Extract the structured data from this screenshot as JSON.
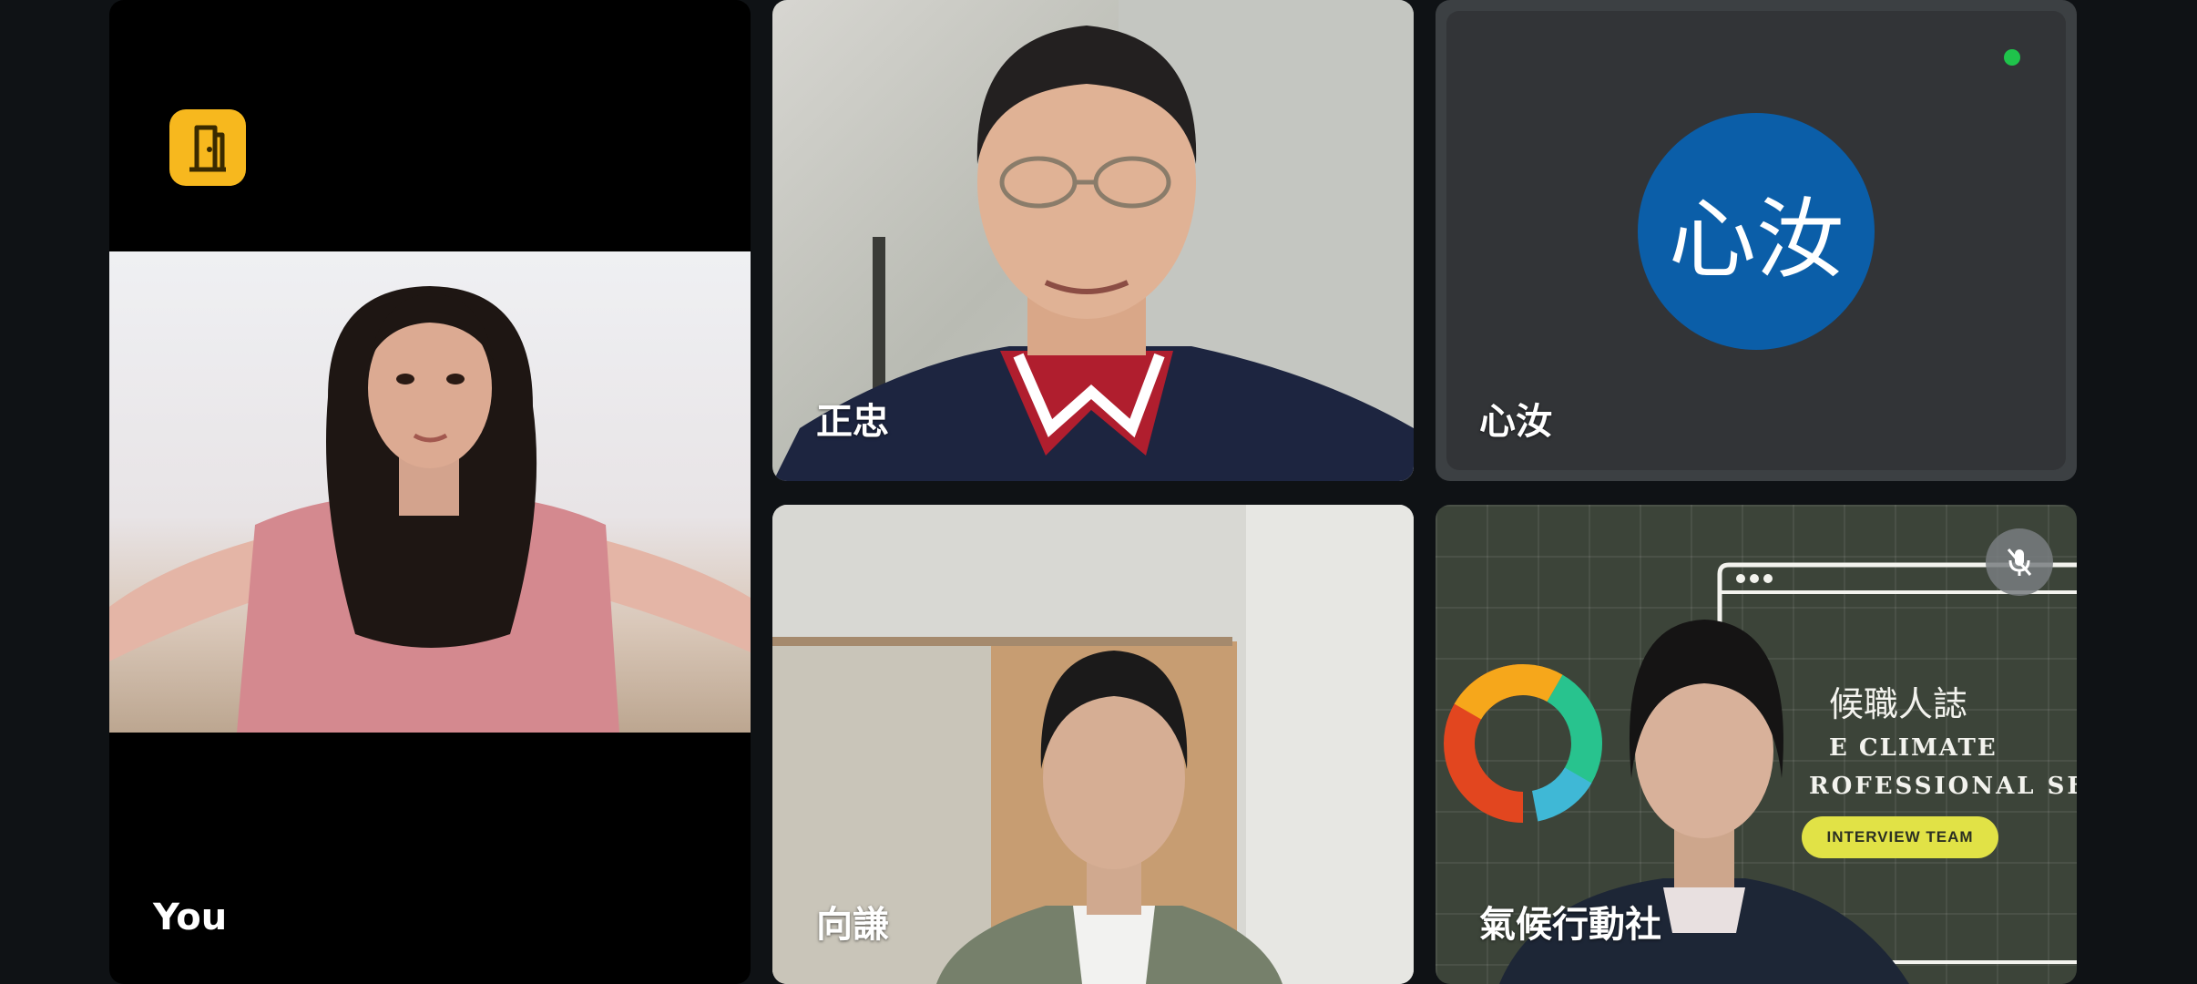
{
  "participants": {
    "you": {
      "name": "You",
      "badge_icon": "door-exit-icon",
      "badge_color": "#f7b81e"
    },
    "zhengzhong": {
      "name": "正忠"
    },
    "xinru": {
      "name": "心汝",
      "avatar_text": "心汝",
      "avatar_color": "#0b5ea8",
      "speaking_indicator_color": "#1fc34b"
    },
    "xiangqian": {
      "name": "向謙"
    },
    "climate": {
      "name": "氣候行動社",
      "muted": true,
      "mute_icon": "mic-off-icon"
    }
  },
  "shared_background": {
    "title_zh": "候職人誌",
    "line1": "E CLIMATE",
    "line2": "ROFESSIONAL SER",
    "button": "INTERVIEW TEAM"
  },
  "colors": {
    "background": "#0f1215",
    "tile_dark": "#3c4043"
  }
}
